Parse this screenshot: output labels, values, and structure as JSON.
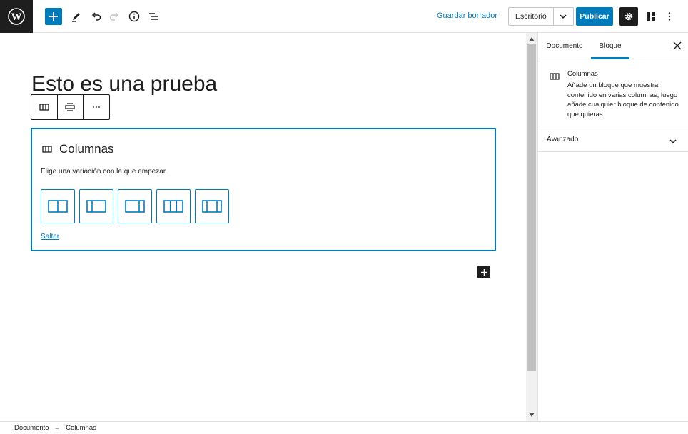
{
  "header": {
    "logo_icon": "wordpress-logo-icon",
    "tools": [
      "add-block-icon",
      "edit-pencil-icon",
      "undo-icon",
      "redo-icon",
      "info-icon",
      "list-view-icon"
    ],
    "save_draft_label": "Guardar borrador",
    "preview_label": "Escritorio",
    "publish_label": "Publicar",
    "accent_color": "#007cba"
  },
  "editor": {
    "post_title": "Esto es una prueba",
    "block_toolbar": [
      "columns-icon",
      "align-icon",
      "more-options-icon"
    ],
    "placeholder": {
      "title": "Columnas",
      "instructions": "Elige una variación con la que empezar.",
      "variations": [
        "50-50",
        "33-66",
        "66-33",
        "33-33-33",
        "25-50-25"
      ],
      "skip_label": "Saltar"
    }
  },
  "sidebar": {
    "tabs": [
      {
        "label": "Documento",
        "active": false
      },
      {
        "label": "Bloque",
        "active": true
      }
    ],
    "block_card": {
      "title": "Columnas",
      "description": "Añade un bloque que muestra contenido en varias columnas, luego añade cualquier bloque de contenido que quieras."
    },
    "panels": [
      {
        "title": "Avanzado",
        "expanded": false
      }
    ]
  },
  "footer": {
    "breadcrumbs": [
      "Documento",
      "→",
      "Columnas"
    ]
  }
}
